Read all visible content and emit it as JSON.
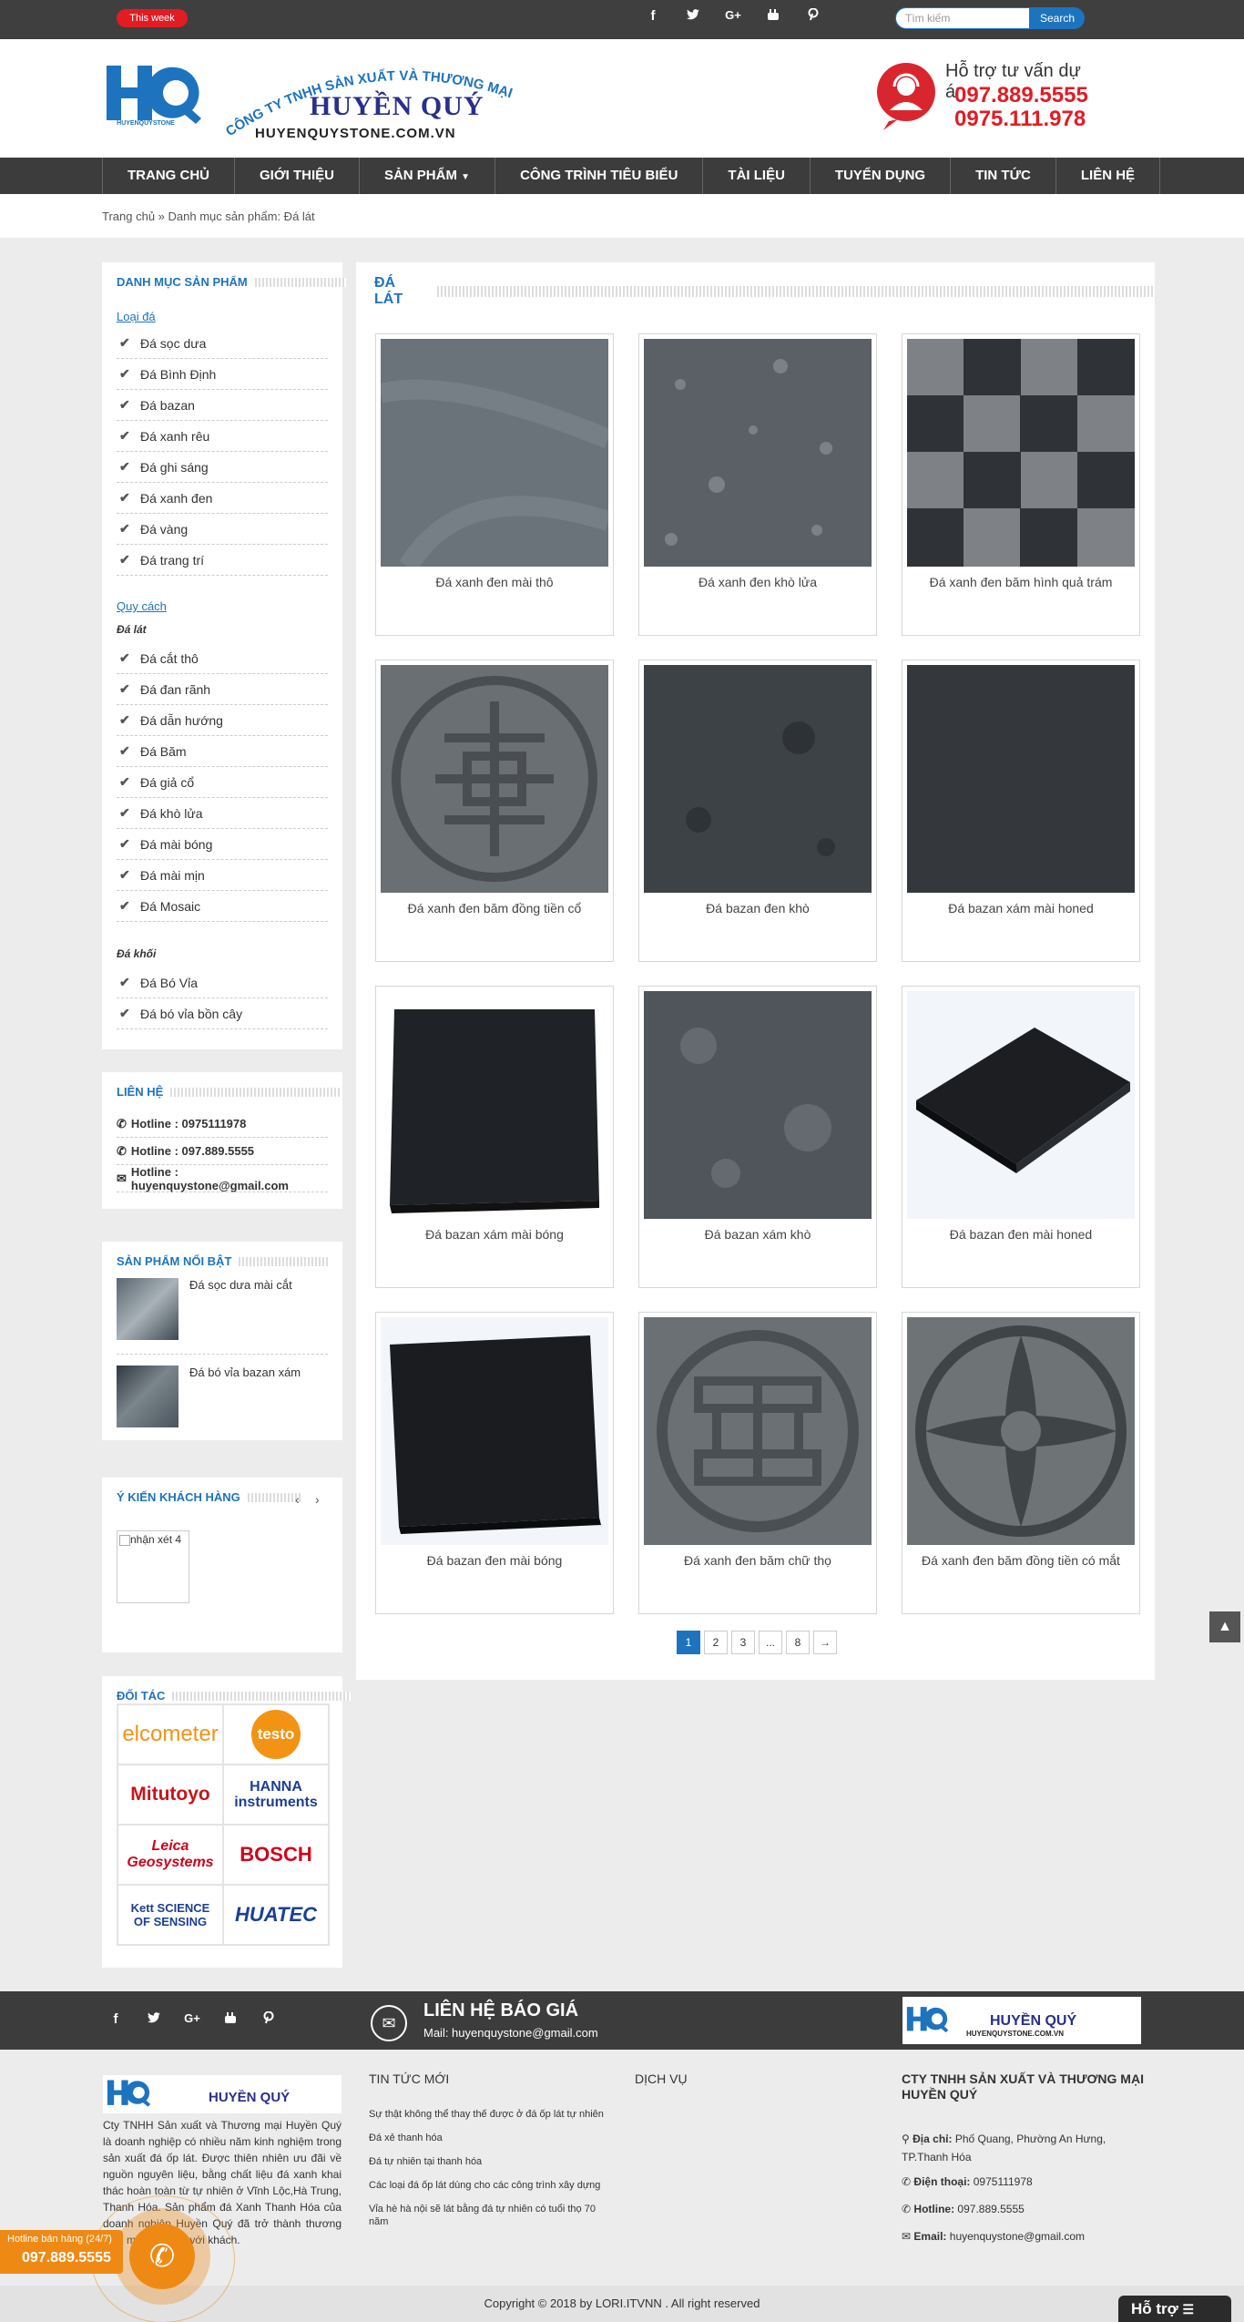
{
  "topbar": {
    "badge": "This week",
    "social_icons": [
      "facebook-icon",
      "twitter-icon",
      "google-plus-icon",
      "youtube-icon",
      "pinterest-icon"
    ],
    "search_placeholder": "Tìm kiếm",
    "search_button": "Search"
  },
  "header": {
    "logo_caption": "HUYENQUYSTONE",
    "company_arc": "CÔNG TY TNHH SẢN XUẤT VÀ THƯƠNG MẠI",
    "brand_name": "HUYỀN QUÝ",
    "website": "HUYENQUYSTONE.COM.VN",
    "support_title": "Hỗ trợ tư vấn dự án",
    "phone1": "097.889.5555",
    "phone2": "0975.111.978"
  },
  "nav": [
    "TRANG CHỦ",
    "GIỚI THIỆU",
    "SẢN PHẨM",
    "CÔNG TRÌNH TIÊU BIỂU",
    "TÀI LIỆU",
    "TUYỂN DỤNG",
    "TIN TỨC",
    "LIÊN HỆ"
  ],
  "breadcrumb": "Trang chủ » Danh mục sản phẩm: Đá lát",
  "sidebar": {
    "categories": {
      "title": "DANH MỤC SẢN PHẨM",
      "group1_link": "Loại đá",
      "group1": [
        "Đá sọc dưa",
        "Đá Bình Định",
        "Đá bazan",
        "Đá xanh rêu",
        "Đá ghi sáng",
        "Đá xanh đen",
        "Đá vàng",
        "Đá trang trí"
      ],
      "group2_link": "Quy cách",
      "group2_sub": "Đá lát",
      "group2": [
        "Đá cắt thô",
        "Đá đan rãnh",
        "Đá dẫn hướng",
        "Đá Băm",
        "Đá giả cổ",
        "Đá khò lửa",
        "Đá mài bóng",
        "Đá mài mịn",
        "Đá Mosaic"
      ],
      "group3_sub": "Đá khối",
      "group3": [
        "Đá Bó Vỉa",
        "Đá bó vỉa bồn cây"
      ]
    },
    "contact": {
      "title": "LIÊN HỆ",
      "lines": [
        "Hotline : 0975111978",
        "Hotline : 097.889.5555",
        "Hotline : huyenquystone@gmail.com"
      ]
    },
    "featured": {
      "title": "SẢN PHẨM NỔI BẬT",
      "items": [
        "Đá sọc dưa mài cắt",
        "Đá bó vỉa bazan xám"
      ]
    },
    "reviews": {
      "title": "Ý KIẾN KHÁCH HÀNG",
      "image_alt": "nhận xét 4"
    },
    "partners": {
      "title": "ĐỐI TÁC",
      "logos": [
        "elcometer",
        "testo",
        "Mitutoyo",
        "HANNA instruments",
        "Leica Geosystems",
        "BOSCH",
        "Kett SCIENCE OF SENSING",
        "HUATEC"
      ]
    }
  },
  "main": {
    "title": "ĐÁ LÁT",
    "products": [
      "Đá xanh đen mài thô",
      "Đá xanh đen khò lửa",
      "Đá xanh đen băm hình quả trám",
      "Đá xanh đen băm đồng tiền cổ",
      "Đá bazan đen khò",
      "Đá bazan xám mài honed",
      "Đá bazan xám mài bóng",
      "Đá bazan xám khò",
      "Đá bazan đen mài honed",
      "Đá bazan đen mài bóng",
      "Đá xanh đen băm chữ thọ",
      "Đá xanh đen băm đồng tiền có mắt"
    ],
    "pagination": [
      "1",
      "2",
      "3",
      "...",
      "8",
      "→"
    ]
  },
  "footer": {
    "contact_title": "LIÊN HỆ BÁO GIÁ",
    "contact_mail": "Mail: huyenquystone@gmail.com",
    "about": "Cty TNHH Sản xuất và Thương mại Huyền Quý là doanh nghiệp có nhiều năm kinh nghiệm trong sản xuất đá ốp lát. Được thiên nhiên ưu đãi về nguồn nguyên liệu, bằng chất liệu đá xanh khai thác hoàn toàn từ tự nhiên ở Vĩnh Lộc,Hà Trung, Thanh Hóa. Sản phẩm đá Xanh Thanh Hóa của doanh nghiệp Huyền Quý đã trở thành thương hiệu mạnh, uy tín với khách.",
    "news_title": "TIN TỨC MỚI",
    "news": [
      "Sự thật không thể thay thế được ở đá ốp lát tự nhiên",
      "Đá xẻ thanh hóa",
      "Đá tự nhiên tại thanh hóa",
      "Các loại đá ốp lát dùng cho các công trình xây dựng",
      "Vỉa hè hà nội sẽ lát bằng đá tự nhiên có tuổi thọ 70 năm"
    ],
    "services_title": "DỊCH VỤ",
    "company_title": "CTY TNHH SẢN XUẤT VÀ THƯƠNG MẠI HUYỀN QUÝ",
    "address_label": "Địa chỉ:",
    "address": "Phố Quang, Phường An Hưng, TP.Thanh Hóa",
    "phone_label": "Điện thoại:",
    "phone": "0975111978",
    "hotline_label": "Hotline:",
    "hotline": "097.889.5555",
    "email_label": "Email:",
    "email": "huyenquystone@gmail.com",
    "copyright": "Copyright © 2018 by LORI.ITVNN . All right reserved"
  },
  "floating": {
    "hotline_label": "Hotline bán hàng (24/7)",
    "hotline_number": "097.889.5555",
    "support_button": "Hỗ trợ"
  },
  "colors": {
    "accent": "#1e73be",
    "topbar": "#3f3f3f",
    "nav": "#3c3c3c",
    "brand_red": "#e31b23",
    "hotline_orange": "#ee8a14"
  }
}
